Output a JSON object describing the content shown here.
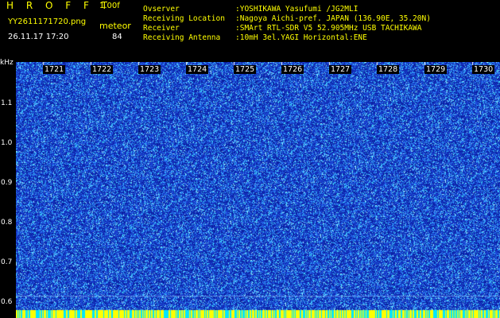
{
  "header": {
    "app_title": "H R O F F T",
    "version": "1.00f",
    "filename": "YY2611171720.png",
    "datetime": "26.11.17 17:20",
    "meteor_label": "meteor",
    "meteor_count": "84",
    "info": [
      {
        "key": "Ovserver",
        "value": ":YOSHIKAWA Yasufumi /JG2MLI"
      },
      {
        "key": "Receiving Location",
        "value": ":Nagoya Aichi-pref. JAPAN (136.90E, 35.20N)"
      },
      {
        "key": "Receiver",
        "value": ":SMArt RTL-SDR V5 52.905MHz USB TACHIKAWA"
      },
      {
        "key": "Receiving Antenna",
        "value": ":10mH 3el.YAGI Horizontal:ENE"
      }
    ]
  },
  "axis": {
    "unit": "kHz",
    "yticks": [
      "1.1",
      "1.0",
      "0.9",
      "0.8",
      "0.7",
      "0.6"
    ],
    "xticks": [
      "1721",
      "1722",
      "1723",
      "1724",
      "1725",
      "1726",
      "1727",
      "1728",
      "1729",
      "1730"
    ]
  },
  "spectrogram": {
    "background_color": "#1a3fd0",
    "noise_colors": [
      "#0a1fa0",
      "#2f8cff",
      "#41d9ff",
      "#9ff0ff"
    ],
    "bottom_band_colors": [
      "#ffff00",
      "#00e5ff"
    ]
  }
}
